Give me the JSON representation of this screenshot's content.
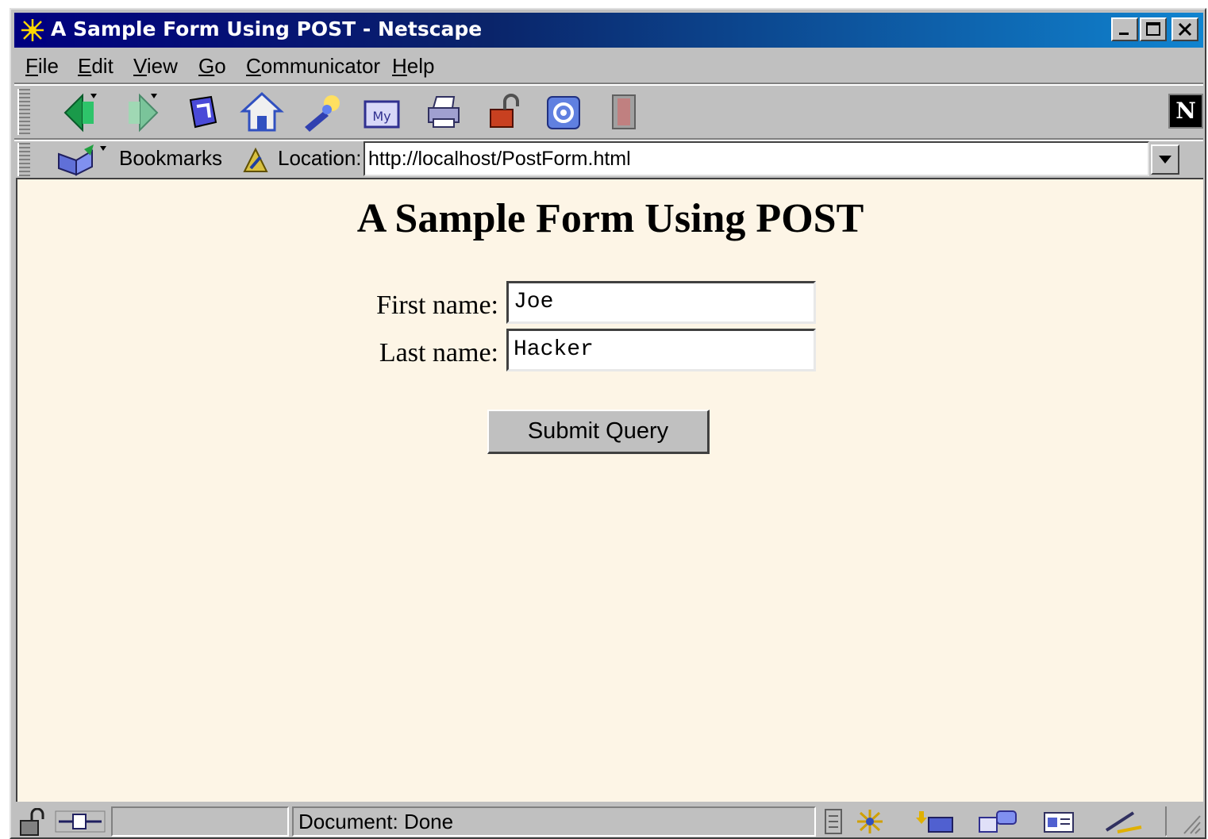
{
  "window": {
    "title": "A Sample Form Using POST - Netscape"
  },
  "menubar": {
    "items": [
      {
        "label": "File",
        "underline": "F",
        "rest": "ile"
      },
      {
        "label": "Edit",
        "underline": "E",
        "rest": "dit"
      },
      {
        "label": "View",
        "underline": "V",
        "rest": "iew"
      },
      {
        "label": "Go",
        "underline": "G",
        "rest": "o"
      },
      {
        "label": "Communicator",
        "underline": "C",
        "rest": "ommunicator"
      },
      {
        "label": "Help",
        "underline": "H",
        "rest": "elp"
      }
    ]
  },
  "toolbar": {
    "buttons": [
      "back-icon",
      "forward-icon",
      "reload-icon",
      "home-icon",
      "search-icon",
      "my-netscape-icon",
      "print-icon",
      "security-icon",
      "shop-icon",
      "stop-icon"
    ],
    "logo": "N"
  },
  "locationbar": {
    "bookmarks_label": "Bookmarks",
    "location_label": "Location:",
    "url": "http://localhost/PostForm.html"
  },
  "page": {
    "title": "A Sample Form Using POST",
    "first_name_label": "First name:",
    "first_name_value": "Joe",
    "last_name_label": "Last name:",
    "last_name_value": "Hacker",
    "submit_label": "Submit Query",
    "background": "#fdf5e6"
  },
  "statusbar": {
    "text": "Document: Done"
  },
  "colors": {
    "title_gradient_start": "#000080",
    "title_gradient_end": "#1084d0",
    "chrome": "#c0c0c0"
  }
}
